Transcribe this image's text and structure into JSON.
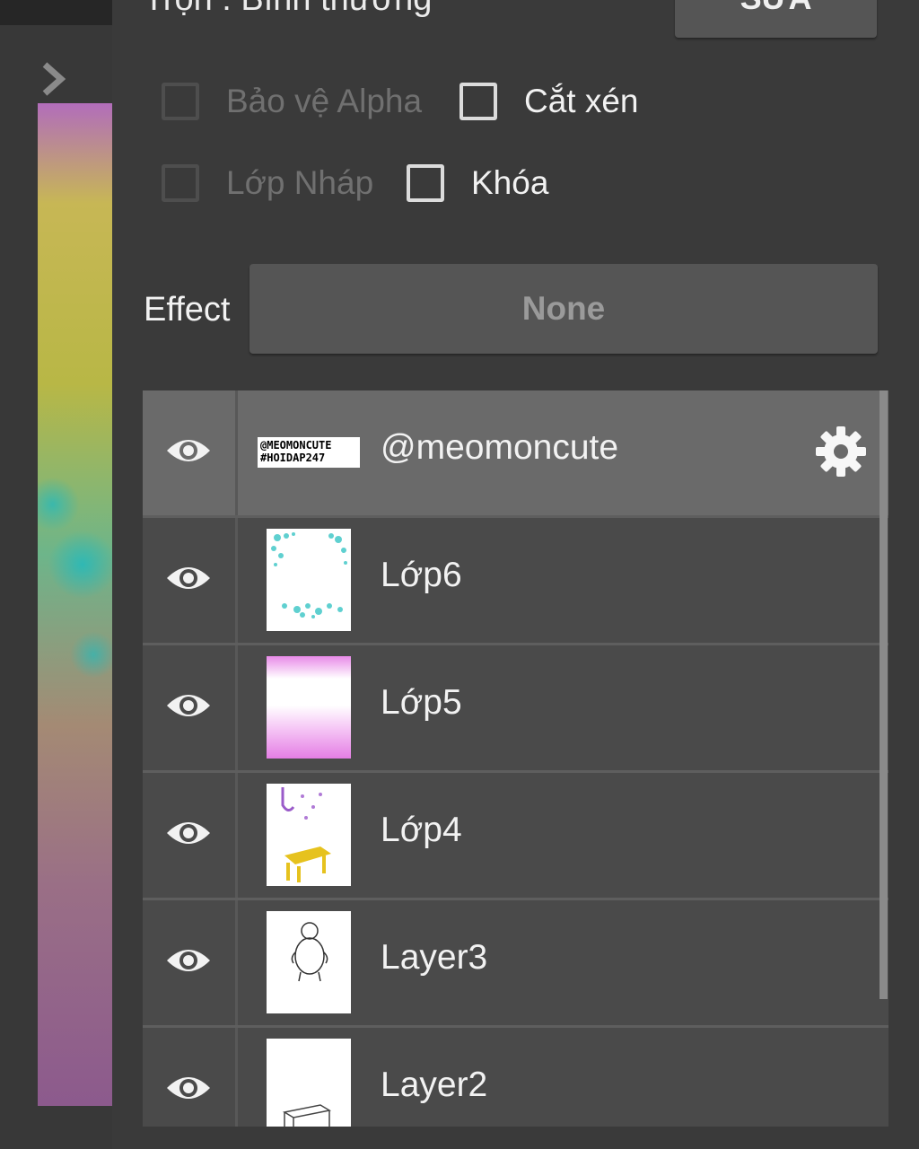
{
  "header": {
    "blend_mode_text": "Trộn : Bình thường",
    "edit_button_label": "SỬA"
  },
  "options": {
    "alpha_protect": {
      "label": "Bảo vệ Alpha",
      "enabled": false,
      "checked": false
    },
    "clipping": {
      "label": "Cắt xén",
      "enabled": true,
      "checked": false
    },
    "draft_layer": {
      "label": "Lớp Nháp",
      "enabled": false,
      "checked": false
    },
    "lock": {
      "label": "Khóa",
      "enabled": true,
      "checked": false
    }
  },
  "effect": {
    "label": "Effect",
    "value": "None"
  },
  "layers": [
    {
      "name": "@meomoncute",
      "visible": true,
      "selected": true,
      "thumbnail": "watermark-text",
      "thumb_text": "@MEOMONCUTE\n#HOIDAP247"
    },
    {
      "name": "Lớp6",
      "visible": true,
      "selected": false,
      "thumbnail": "cyan-sparkles"
    },
    {
      "name": "Lớp5",
      "visible": true,
      "selected": false,
      "thumbnail": "pink-gradient"
    },
    {
      "name": "Lớp4",
      "visible": true,
      "selected": false,
      "thumbnail": "yellow-table"
    },
    {
      "name": "Layer3",
      "visible": true,
      "selected": false,
      "thumbnail": "bear-sketch"
    },
    {
      "name": "Layer2",
      "visible": true,
      "selected": false,
      "thumbnail": "table-sketch"
    }
  ],
  "icons": {
    "visibility": "eye-icon",
    "settings": "gear-icon",
    "expand": "chevron-right-icon"
  },
  "colors": {
    "panel_background": "#3a3a3a",
    "button_background": "#555555",
    "layer_row": "#4a4a4a",
    "layer_row_selected": "#6a6a6a",
    "text_primary": "#f2f2f2",
    "text_disabled": "#707070"
  }
}
